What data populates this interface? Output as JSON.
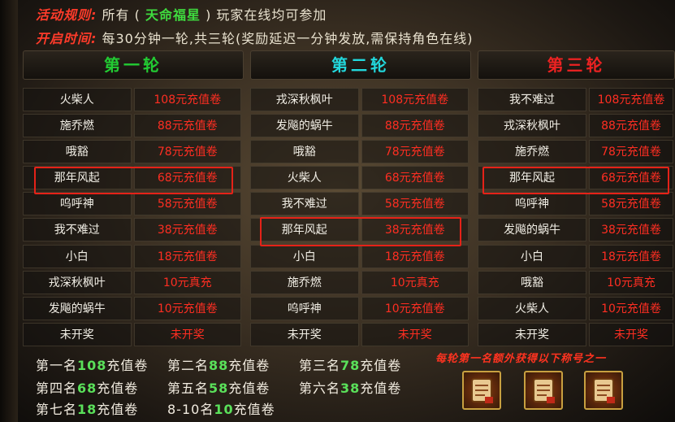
{
  "rules": {
    "line1": {
      "label": "活动规则:",
      "pre": "所有",
      "open": "(",
      "highlight": "天命福星",
      "close": ")",
      "post": "玩家在线均可参加"
    },
    "line2": {
      "label": "开启时间:",
      "text": "每30分钟一轮,共三轮(奖励延迟一分钟发放,需保持角色在线)"
    }
  },
  "rounds": [
    {
      "title": "第一轮",
      "title_color": "#22cc33",
      "rows": [
        {
          "name": "火柴人",
          "prize": "108元充值卷"
        },
        {
          "name": "施乔燃",
          "prize": "88元充值卷"
        },
        {
          "name": "哦豁",
          "prize": "78元充值卷"
        },
        {
          "name": "那年风起",
          "prize": "68元充值卷"
        },
        {
          "name": "呜呼神",
          "prize": "58元充值卷"
        },
        {
          "name": "我不难过",
          "prize": "38元充值卷"
        },
        {
          "name": "小白",
          "prize": "18元充值卷"
        },
        {
          "name": "戎深秋枫叶",
          "prize": "10元真充"
        },
        {
          "name": "发飚的蜗牛",
          "prize": "10元充值卷"
        },
        {
          "name": "未开奖",
          "prize": "未开奖"
        }
      ]
    },
    {
      "title": "第二轮",
      "title_color": "#22d8dd",
      "rows": [
        {
          "name": "戎深秋枫叶",
          "prize": "108元充值卷"
        },
        {
          "name": "发飚的蜗牛",
          "prize": "88元充值卷"
        },
        {
          "name": "哦豁",
          "prize": "78元充值卷"
        },
        {
          "name": "火柴人",
          "prize": "68元充值卷"
        },
        {
          "name": "我不难过",
          "prize": "58元充值卷"
        },
        {
          "name": "那年风起",
          "prize": "38元充值卷"
        },
        {
          "name": "小白",
          "prize": "18元充值卷"
        },
        {
          "name": "施乔燃",
          "prize": "10元真充"
        },
        {
          "name": "呜呼神",
          "prize": "10元充值卷"
        },
        {
          "name": "未开奖",
          "prize": "未开奖"
        }
      ]
    },
    {
      "title": "第三轮",
      "title_color": "#ee2222",
      "rows": [
        {
          "name": "我不难过",
          "prize": "108元充值卷"
        },
        {
          "name": "戎深秋枫叶",
          "prize": "88元充值卷"
        },
        {
          "name": "施乔燃",
          "prize": "78元充值卷"
        },
        {
          "name": "那年风起",
          "prize": "68元充值卷"
        },
        {
          "name": "呜呼神",
          "prize": "58元充值卷"
        },
        {
          "name": "发飚的蜗牛",
          "prize": "38元充值卷"
        },
        {
          "name": "小白",
          "prize": "18元充值卷"
        },
        {
          "name": "哦豁",
          "prize": "10元真充"
        },
        {
          "name": "火柴人",
          "prize": "10元充值卷"
        },
        {
          "name": "未开奖",
          "prize": "未开奖"
        }
      ]
    }
  ],
  "ranks": [
    {
      "label": "第一名",
      "num": "108",
      "unit": "充值卷"
    },
    {
      "label": "第二名",
      "num": "88",
      "unit": "充值卷"
    },
    {
      "label": "第三名",
      "num": "78",
      "unit": "充值卷"
    },
    {
      "label": "第四名",
      "num": "68",
      "unit": "充值卷"
    },
    {
      "label": "第五名",
      "num": "58",
      "unit": "充值卷"
    },
    {
      "label": "第六名",
      "num": "38",
      "unit": "充值卷"
    },
    {
      "label": "第七名",
      "num": "18",
      "unit": "充值卷"
    },
    {
      "label": "8-10名",
      "num": "10",
      "unit": "充值卷"
    }
  ],
  "title_note": "每轮第一名额外获得以下称号之一",
  "icons": [
    "scroll-icon",
    "scroll-icon",
    "scroll-icon"
  ],
  "colors": {
    "prize": "#ff2e22",
    "highlight_border": "#e52218",
    "rank_number": "#5ae05a"
  }
}
